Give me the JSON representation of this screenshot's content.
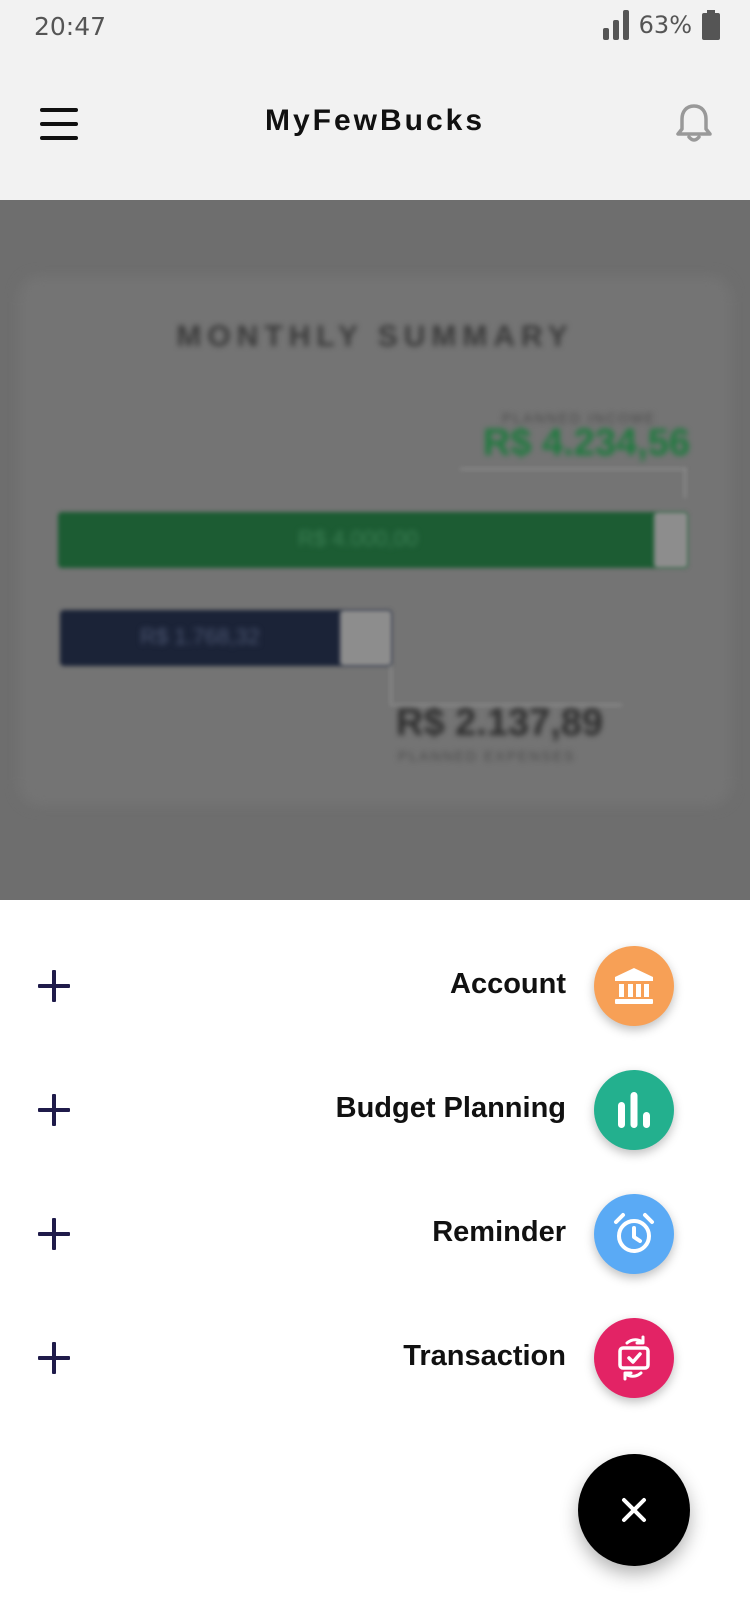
{
  "status_bar": {
    "time": "20:47",
    "battery": "63%"
  },
  "header": {
    "title": "MyFewBucks",
    "menu_icon": "hamburger-menu-icon",
    "notification_icon": "bell-icon"
  },
  "summary": {
    "title": "MONTHLY SUMMARY",
    "planned_income_label": "PLANNED INCOME",
    "planned_income_value": "R$ 4.234,56",
    "income_bar_value": "R$ 4.000,00",
    "expense_bar_value": "R$ 1.768,32",
    "planned_expenses_value": "R$ 2.137,89",
    "planned_expenses_label": "PLANNED EXPENSES"
  },
  "quick_add": {
    "items": [
      {
        "label": "Account",
        "icon": "bank-icon",
        "color": "#F7A056"
      },
      {
        "label": "Budget Planning",
        "icon": "bar-chart-icon",
        "color": "#23B08E"
      },
      {
        "label": "Reminder",
        "icon": "alarm-clock-icon",
        "color": "#5AAAF5"
      },
      {
        "label": "Transaction",
        "icon": "money-exchange-icon",
        "color": "#E32365"
      }
    ],
    "close_icon": "close-icon"
  }
}
